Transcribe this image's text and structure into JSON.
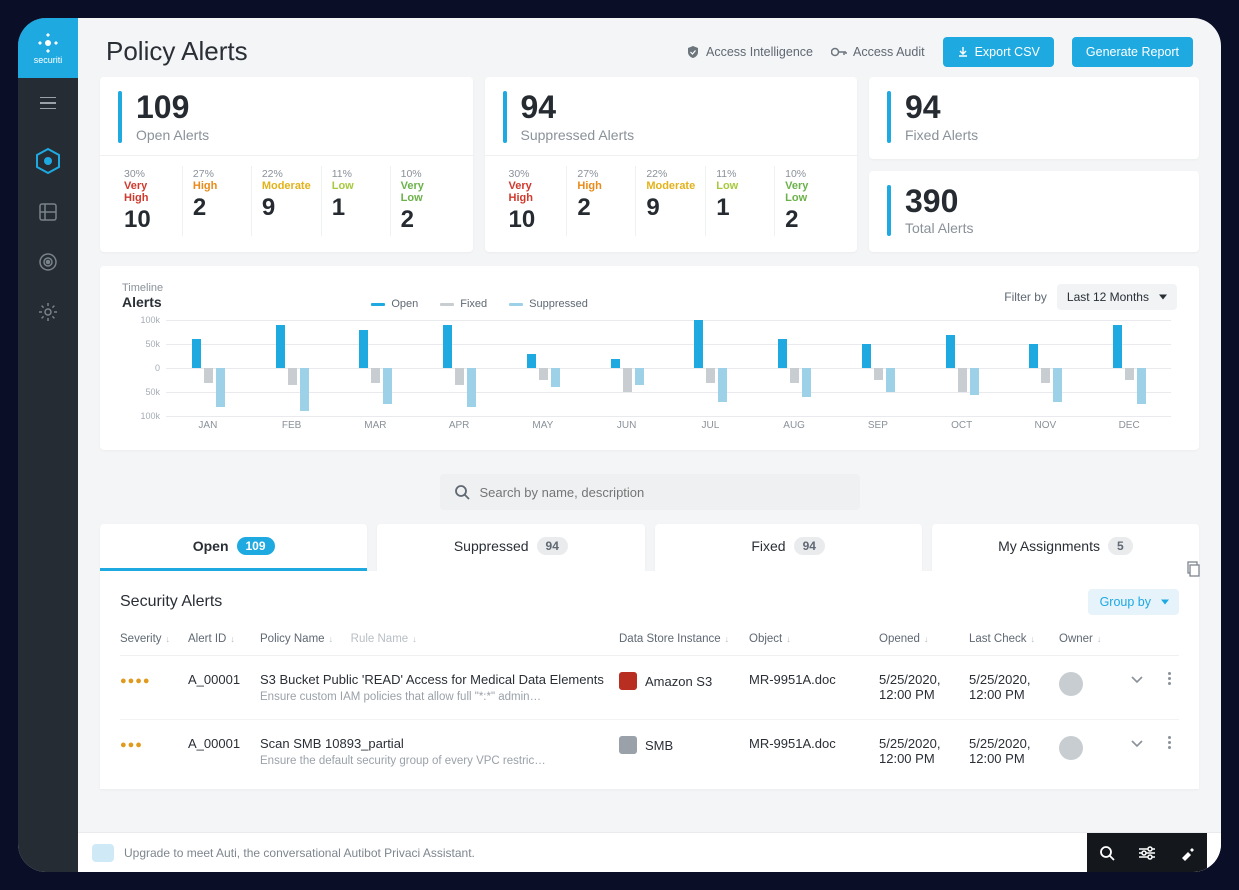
{
  "brand": "securiti",
  "page_title": "Policy Alerts",
  "top_links": [
    {
      "icon": "shield-check-icon",
      "label": "Access Intelligence"
    },
    {
      "icon": "key-icon",
      "label": "Access Audit"
    }
  ],
  "buttons": {
    "export": "Export CSV",
    "report": "Generate Report"
  },
  "summary": {
    "open": {
      "value": "109",
      "label": "Open Alerts"
    },
    "suppressed": {
      "value": "94",
      "label": "Suppressed Alerts"
    },
    "fixed": {
      "value": "94",
      "label": "Fixed Alerts"
    },
    "total": {
      "value": "390",
      "label": "Total Alerts"
    }
  },
  "severity": [
    {
      "pct": "30%",
      "name": "Very High",
      "cls": "c-veryhigh",
      "count": "10"
    },
    {
      "pct": "27%",
      "name": "High",
      "cls": "c-high",
      "count": "2"
    },
    {
      "pct": "22%",
      "name": "Moderate",
      "cls": "c-moderate",
      "count": "9"
    },
    {
      "pct": "11%",
      "name": "Low",
      "cls": "c-low",
      "count": "1"
    },
    {
      "pct": "10%",
      "name": "Very Low",
      "cls": "c-verylow",
      "count": "2"
    }
  ],
  "timeline": {
    "subtitle": "Timeline",
    "title": "Alerts",
    "legend": {
      "open": "Open",
      "fixed": "Fixed",
      "supp": "Suppressed"
    },
    "filter_label": "Filter by",
    "filter_value": "Last 12 Months",
    "yticks": [
      "100k",
      "50k",
      "0",
      "50k",
      "100k"
    ]
  },
  "chart_data": {
    "type": "bar",
    "categories": [
      "JAN",
      "FEB",
      "MAR",
      "APR",
      "MAY",
      "JUN",
      "JUL",
      "AUG",
      "SEP",
      "OCT",
      "NOV",
      "DEC"
    ],
    "series": [
      {
        "name": "Open",
        "values": [
          60,
          90,
          80,
          90,
          30,
          20,
          100,
          60,
          50,
          70,
          50,
          90
        ]
      },
      {
        "name": "Fixed",
        "values": [
          -30,
          -35,
          -30,
          -35,
          -25,
          -50,
          -30,
          -30,
          -25,
          -50,
          -30,
          -25
        ]
      },
      {
        "name": "Suppressed",
        "values": [
          -80,
          -90,
          -75,
          -80,
          -40,
          -35,
          -70,
          -60,
          -50,
          -55,
          -70,
          -75
        ]
      }
    ],
    "ylabel": "",
    "xlabel": "",
    "ylim": [
      -100000,
      100000
    ]
  },
  "search_placeholder": "Search by name, description",
  "tabs": [
    {
      "label": "Open",
      "count": "109",
      "active": true
    },
    {
      "label": "Suppressed",
      "count": "94",
      "active": false
    },
    {
      "label": "Fixed",
      "count": "94",
      "active": false
    },
    {
      "label": "My Assignments",
      "count": "5",
      "active": false
    }
  ],
  "table": {
    "title": "Security Alerts",
    "group_by": "Group by",
    "columns": {
      "severity": "Severity",
      "alert_id": "Alert ID",
      "policy": "Policy Name",
      "rule": "Rule Name",
      "ds": "Data Store Instance",
      "object": "Object",
      "opened": "Opened",
      "last_check": "Last Check",
      "owner": "Owner"
    },
    "rows": [
      {
        "sev_level": 4,
        "alert_id": "A_00001",
        "policy": "S3 Bucket Public 'READ' Access for Medical Data Elements",
        "policy_sub": "Ensure custom IAM policies that allow full \"*:*\" admin…",
        "ds_icon": "s3-icon",
        "ds_color": "#b82f22",
        "ds": "Amazon S3",
        "object": "MR-9951A.doc",
        "opened": "5/25/2020, 12:00 PM",
        "last_check": "5/25/2020, 12:00 PM"
      },
      {
        "sev_level": 3,
        "alert_id": "A_00001",
        "policy": "Scan SMB 10893_partial",
        "policy_sub": "Ensure the default security group of every VPC restric…",
        "ds_icon": "smb-icon",
        "ds_color": "#9aa1a8",
        "ds": "SMB",
        "object": "MR-9951A.doc",
        "opened": "5/25/2020, 12:00 PM",
        "last_check": "5/25/2020, 12:00 PM"
      }
    ]
  },
  "footer_msg": "Upgrade to meet Auti, the conversational Autibot Privaci Assistant."
}
